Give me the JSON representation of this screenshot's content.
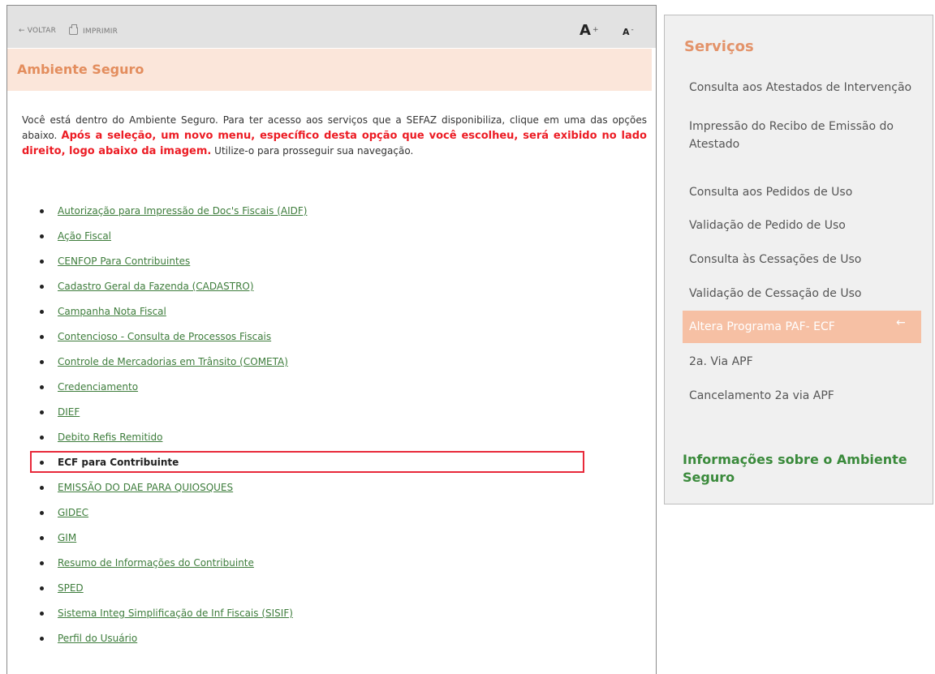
{
  "toolbar": {
    "back_label": "← VOLTAR",
    "print_label": "IMPRIMIR",
    "font_increase": "A",
    "font_increase_sign": "+",
    "font_decrease": "A",
    "font_decrease_sign": "-"
  },
  "page": {
    "title": "Ambiente Seguro",
    "intro_part1": "Você está dentro do Ambiente Seguro. Para ter acesso aos serviços que a SEFAZ disponibiliza, clique em uma das opções abaixo.",
    "intro_highlight": "Após a seleção, um novo menu, específico desta opção que você escolheu, será exibido no lado direito, logo abaixo da imagem.",
    "intro_part2": "Utilize-o para prosseguir sua navegação."
  },
  "menu": {
    "items": [
      "Autorização para Impressão de Doc's Fiscais (AIDF)",
      "Ação Fiscal",
      "CENFOP Para Contribuintes",
      "Cadastro Geral da Fazenda (CADASTRO)",
      "Campanha Nota Fiscal",
      "Contencioso - Consulta de Processos Fiscais",
      "Controle de Mercadorias em Trânsito (COMETA)",
      "Credenciamento",
      "DIEF",
      "Debito Refis Remitido",
      "ECF para Contribuinte",
      "EMISSÃO DO DAE PARA QUIOSQUES",
      "GIDEC",
      "GIM",
      "Resumo de Informações do Contribuinte",
      "SPED",
      "Sistema Integ Simplificação de Inf Fiscais (SISIF)",
      "Perfil do Usuário"
    ],
    "active_index": 10
  },
  "services": {
    "title": "Serviços",
    "items": [
      "Consulta aos Atestados de Intervenção",
      "Impressão do Recibo de Emissão do Atestado",
      "Consulta aos Pedidos de Uso",
      "Validação de Pedido de Uso",
      "Consulta às Cessações de Uso",
      "Validação de Cessação de Uso",
      "Altera Programa PAF- ECF",
      "2a. Via APF",
      "Cancelamento 2a via APF"
    ],
    "active_arrow": "←",
    "info_link": "Informações sobre o Ambiente Seguro"
  },
  "colors": {
    "title_orange": "#e38d5d",
    "link_green": "#3e7d3c",
    "highlight_red": "#ec1c24",
    "active_bg": "#f6c0a4"
  }
}
